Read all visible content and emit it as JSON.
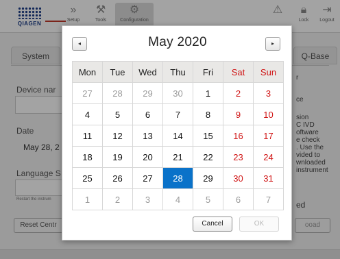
{
  "app": {
    "brand": "QIAGEN",
    "nav": [
      {
        "label": "Setup",
        "icon": "chevrons-icon"
      },
      {
        "label": "Tools",
        "icon": "tools-icon"
      },
      {
        "label": "Configuration",
        "icon": "gear-icon"
      }
    ],
    "right_nav": [
      {
        "label": "Lock",
        "icon": "lock-icon"
      },
      {
        "label": "Logout",
        "icon": "logout-icon"
      }
    ],
    "tabs": {
      "system": "System",
      "qbase": "Q-Base"
    },
    "device_name_label": "Device nar",
    "date_label": "Date",
    "date_value": "May 28, 2",
    "language_label": "Language S",
    "restart_note": "Restart the instrum",
    "reset_button": "Reset Centr",
    "side_text": [
      "r",
      "",
      "ce",
      "",
      "sion",
      "C IVD",
      "oftware",
      "e check",
      ". Use the",
      "vided to",
      "wnloaded",
      "instrument"
    ],
    "side_lower": "ed",
    "side_btn": "ooad"
  },
  "datepicker": {
    "month_title": "May  2020",
    "prev_label": "◂",
    "next_label": "▸",
    "weekdays": [
      "Mon",
      "Tue",
      "Wed",
      "Thu",
      "Fri",
      "Sat",
      "Sun"
    ],
    "weeks": [
      [
        "27",
        "28",
        "29",
        "30",
        "1",
        "2",
        "3"
      ],
      [
        "4",
        "5",
        "6",
        "7",
        "8",
        "9",
        "10"
      ],
      [
        "11",
        "12",
        "13",
        "14",
        "15",
        "16",
        "17"
      ],
      [
        "18",
        "19",
        "20",
        "21",
        "22",
        "23",
        "24"
      ],
      [
        "25",
        "26",
        "27",
        "28",
        "29",
        "30",
        "31"
      ],
      [
        "1",
        "2",
        "3",
        "4",
        "5",
        "6",
        "7"
      ]
    ],
    "selected_day": "28",
    "cancel_label": "Cancel",
    "ok_label": "OK",
    "colors": {
      "selected": "#0a72c9",
      "weekend": "#d01414",
      "other_month": "#9a9a9a"
    }
  }
}
